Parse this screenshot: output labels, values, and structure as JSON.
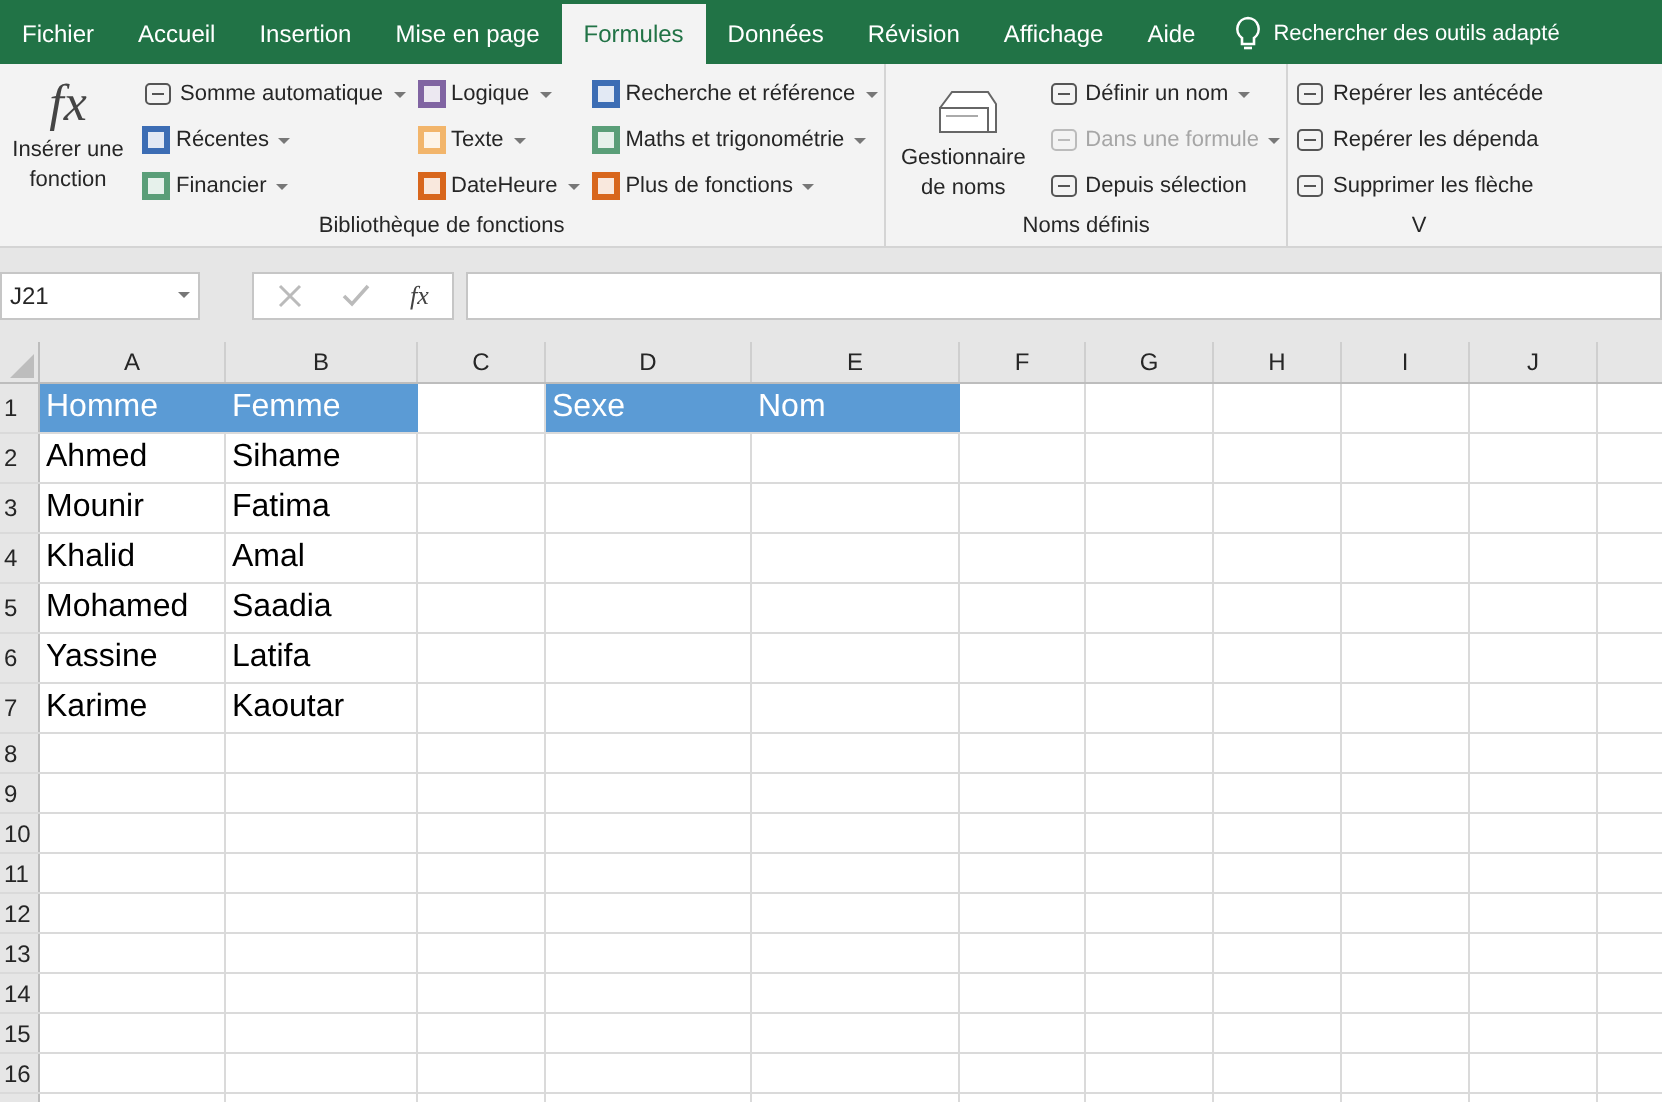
{
  "tabs": [
    {
      "label": "Fichier",
      "selected": false
    },
    {
      "label": "Accueil",
      "selected": false
    },
    {
      "label": "Insertion",
      "selected": false
    },
    {
      "label": "Mise en page",
      "selected": false
    },
    {
      "label": "Formules",
      "selected": true
    },
    {
      "label": "Données",
      "selected": false
    },
    {
      "label": "Révision",
      "selected": false
    },
    {
      "label": "Affichage",
      "selected": false
    },
    {
      "label": "Aide",
      "selected": false
    }
  ],
  "tell_me": "Rechercher des outils adapté",
  "ribbon": {
    "groups": [
      {
        "label": "Bibliothèque de fonctions",
        "large": [
          {
            "glyph": "fx",
            "label": "Insérer une fonction",
            "kind": "fx"
          }
        ],
        "columns": [
          [
            {
              "label": "Somme automatique",
              "dropdown": true,
              "disabled": false
            },
            {
              "label": "Récentes",
              "dropdown": true,
              "disabled": false,
              "color": "#3c6db4"
            },
            {
              "label": "Financier",
              "dropdown": true,
              "disabled": false,
              "color": "#5a9e78"
            }
          ],
          [
            {
              "label": "Logique",
              "dropdown": true,
              "disabled": false,
              "color": "#8064a2"
            },
            {
              "label": "Texte",
              "dropdown": true,
              "disabled": false,
              "color": "#f2b56b"
            },
            {
              "label": "DateHeure",
              "dropdown": true,
              "disabled": false,
              "color": "#d8661c"
            }
          ],
          [
            {
              "label": "Recherche et référence",
              "dropdown": true,
              "disabled": false,
              "color": "#3c6db4"
            },
            {
              "label": "Maths et trigonométrie",
              "dropdown": true,
              "disabled": false,
              "color": "#5a9e78"
            },
            {
              "label": "Plus de fonctions",
              "dropdown": true,
              "disabled": false,
              "color": "#d8661c"
            }
          ]
        ]
      },
      {
        "label": "Noms définis",
        "large": [
          {
            "label": "Gestionnaire de noms",
            "kind": "names"
          }
        ],
        "columns": [
          [
            {
              "label": "Définir un nom",
              "dropdown": true,
              "disabled": false
            },
            {
              "label": "Dans une formule",
              "dropdown": true,
              "disabled": true
            },
            {
              "label": "Depuis sélection",
              "dropdown": false,
              "disabled": false
            }
          ]
        ]
      },
      {
        "label": "V",
        "columns": [
          [
            {
              "label": "Repérer les antécéde",
              "dropdown": false,
              "disabled": false
            },
            {
              "label": "Repérer les dépenda",
              "dropdown": false,
              "disabled": false
            },
            {
              "label": "Supprimer les flèche",
              "dropdown": false,
              "disabled": false
            }
          ]
        ]
      }
    ]
  },
  "formula_bar": {
    "name_box": "J21",
    "fx": "fx"
  },
  "sheet": {
    "columns": [
      "A",
      "B",
      "C",
      "D",
      "E",
      "F",
      "G",
      "H",
      "I",
      "J"
    ],
    "rows": [
      {
        "number": "1",
        "cells": [
          {
            "text": "Homme",
            "filled": true
          },
          {
            "text": "Femme",
            "filled": true
          },
          {
            "filled": false
          },
          {
            "text": "Sexe",
            "filled": true
          },
          {
            "text": "Nom",
            "filled": true
          }
        ]
      },
      {
        "number": "2",
        "cells": [
          {
            "text": "Ahmed",
            "filled": false
          },
          {
            "text": "Sihame",
            "filled": false
          }
        ]
      },
      {
        "number": "3",
        "cells": [
          {
            "text": "Mounir",
            "filled": false
          },
          {
            "text": "Fatima",
            "filled": false
          }
        ]
      },
      {
        "number": "4",
        "cells": [
          {
            "text": "Khalid",
            "filled": false
          },
          {
            "text": "Amal",
            "filled": false
          }
        ]
      },
      {
        "number": "5",
        "cells": [
          {
            "text": "Mohamed",
            "filled": false
          },
          {
            "text": "Saadia",
            "filled": false
          }
        ]
      },
      {
        "number": "6",
        "cells": [
          {
            "text": "Yassine",
            "filled": false
          },
          {
            "text": "Latifa",
            "filled": false
          }
        ]
      },
      {
        "number": "7",
        "cells": [
          {
            "text": "Karime",
            "filled": false
          },
          {
            "text": "Kaoutar",
            "filled": false
          }
        ]
      },
      {
        "number": "8",
        "cells": []
      },
      {
        "number": "9",
        "cells": []
      },
      {
        "number": "10",
        "cells": []
      },
      {
        "number": "11",
        "cells": []
      },
      {
        "number": "12",
        "cells": []
      },
      {
        "number": "13",
        "cells": []
      },
      {
        "number": "14",
        "cells": []
      },
      {
        "number": "15",
        "cells": []
      },
      {
        "number": "16",
        "cells": []
      }
    ]
  }
}
